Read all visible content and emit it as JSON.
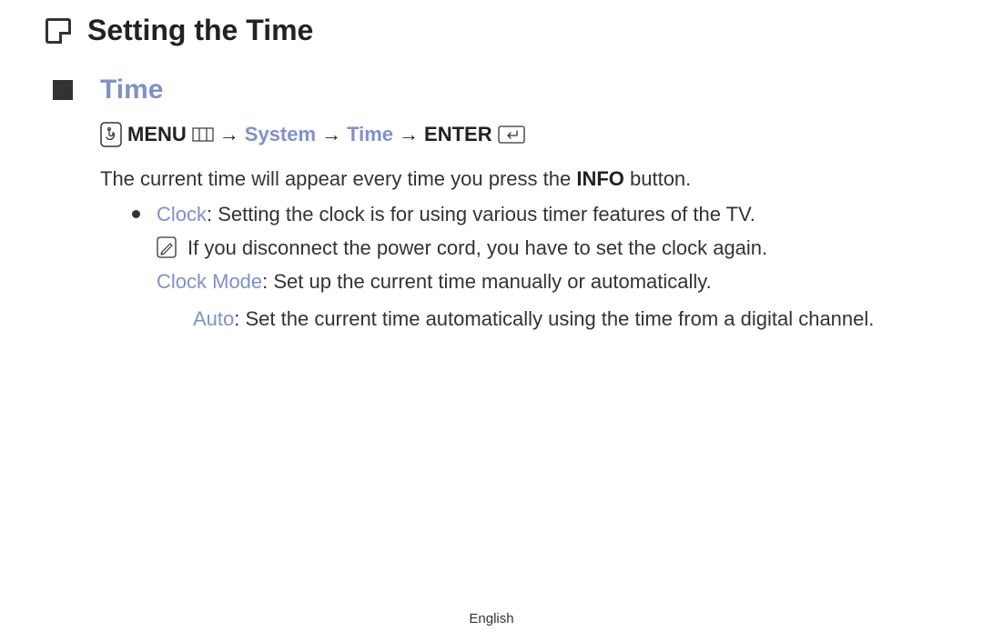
{
  "title": "Setting the Time",
  "section_title": "Time",
  "nav": {
    "menu": "MENU",
    "system": "System",
    "time": "Time",
    "enter": "ENTER",
    "arrow": "→"
  },
  "intro_before": "The current time will appear every time you press the ",
  "intro_bold": "INFO",
  "intro_after": " button.",
  "clock": {
    "label": "Clock",
    "text": ": Setting the clock is for using various timer features of the TV.",
    "note": "If you disconnect the power cord, you have to set the clock again.",
    "mode_label": "Clock Mode",
    "mode_text": ": Set up the current time manually or automatically.",
    "auto_label": "Auto",
    "auto_text": ": Set the current time automatically using the time from a digital channel."
  },
  "footer": "English"
}
